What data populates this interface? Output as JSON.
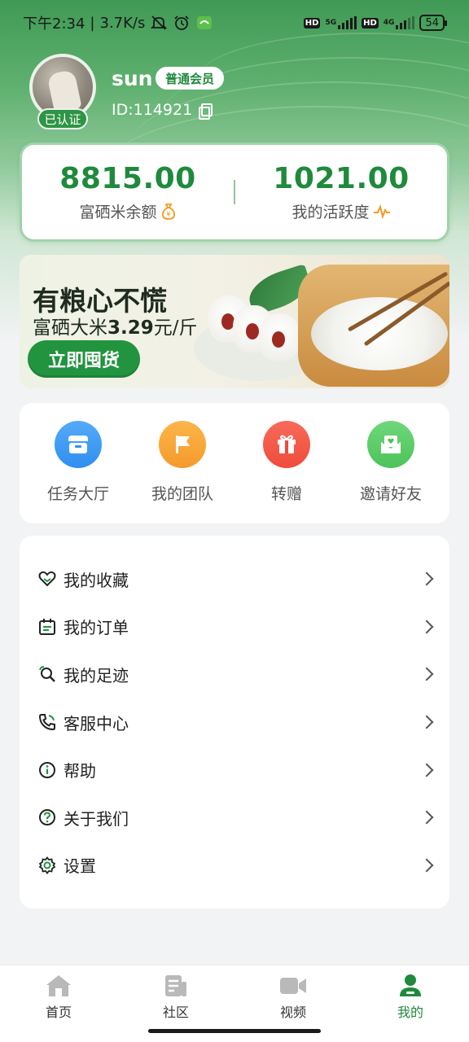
{
  "status_bar": {
    "time": "下午2:34",
    "speed": "3.7K/s",
    "battery": "54",
    "sim1_network": "5G",
    "sim2_network": "4G",
    "hd_label": "HD"
  },
  "profile": {
    "username": "sun",
    "member_badge": "普通会员",
    "user_id": "ID:114921",
    "verified_label": "已认证"
  },
  "stats": {
    "balance_value": "8815.00",
    "balance_label": "富硒米余额",
    "activity_value": "1021.00",
    "activity_label": "我的活跃度"
  },
  "banner": {
    "headline": "有粮心不慌",
    "sub_prefix": "富硒大米",
    "sub_price": "3.29",
    "sub_suffix": "元/斤",
    "cta": "立即囤货"
  },
  "quick_actions": [
    {
      "label": "任务大厅",
      "icon": "task-hall-icon",
      "color": "#2f8ff0"
    },
    {
      "label": "我的团队",
      "icon": "team-flag-icon",
      "color": "#f59a2a"
    },
    {
      "label": "转赠",
      "icon": "gift-icon",
      "color": "#ef4c3c"
    },
    {
      "label": "邀请好友",
      "icon": "invite-mail-icon",
      "color": "#4cc35a"
    }
  ],
  "menu": [
    {
      "label": "我的收藏",
      "icon": "heart-icon"
    },
    {
      "label": "我的订单",
      "icon": "calendar-order-icon"
    },
    {
      "label": "我的足迹",
      "icon": "footprint-search-icon"
    },
    {
      "label": "客服中心",
      "icon": "phone-icon"
    },
    {
      "label": "帮助",
      "icon": "info-icon"
    },
    {
      "label": "关于我们",
      "icon": "question-icon"
    },
    {
      "label": "设置",
      "icon": "gear-icon"
    }
  ],
  "tabs": [
    {
      "label": "首页",
      "icon": "home-icon"
    },
    {
      "label": "社区",
      "icon": "community-icon"
    },
    {
      "label": "视频",
      "icon": "video-icon"
    },
    {
      "label": "我的",
      "icon": "profile-icon",
      "active": true
    }
  ],
  "colors": {
    "brand_green": "#1f8a3c",
    "accent_orange": "#f39a1e"
  }
}
